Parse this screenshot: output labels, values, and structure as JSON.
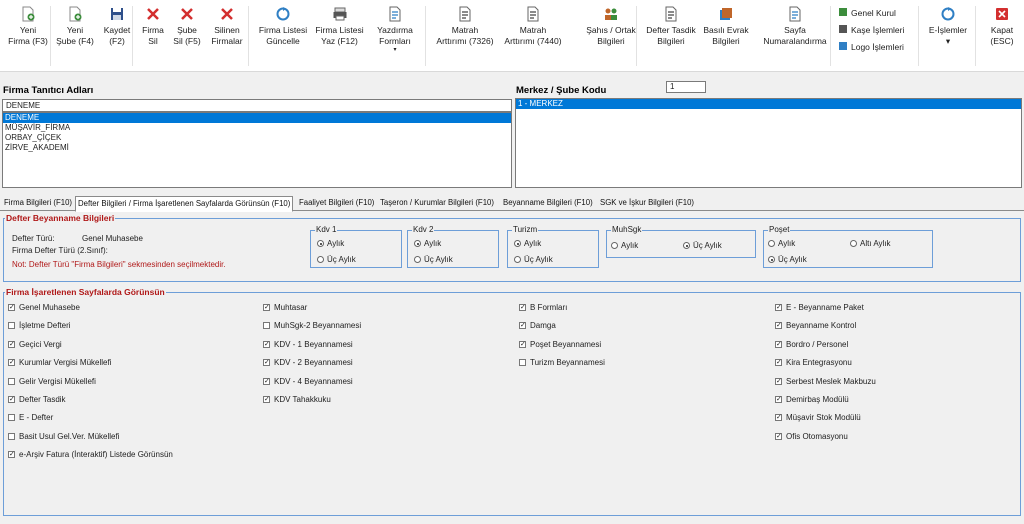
{
  "toolbar": {
    "buttons": [
      {
        "label1": "Yeni",
        "label2": "Firma (F3)",
        "icon": "new-company-icon",
        "color": "#3c8d3c"
      },
      {
        "label1": "Yeni",
        "label2": "Şube (F4)",
        "icon": "new-branch-icon",
        "color": "#3c8d3c"
      },
      {
        "label1": "Kaydet",
        "label2": "(F2)",
        "icon": "save-icon",
        "color": "#2e4f8a"
      },
      {
        "label1": "Firma",
        "label2": "Sil",
        "icon": "delete-company-icon",
        "color": "#d32f2f"
      },
      {
        "label1": "Şube",
        "label2": "Sil (F5)",
        "icon": "delete-branch-icon",
        "color": "#d32f2f"
      },
      {
        "label1": "Silinen",
        "label2": "Firmalar",
        "icon": "deleted-companies-icon",
        "color": "#d32f2f"
      },
      {
        "label1": "Firma Listesi",
        "label2": "Güncelle",
        "icon": "refresh-list-icon",
        "color": "#2f7fc4"
      },
      {
        "label1": "Firma Listesi",
        "label2": "Yaz (F12)",
        "icon": "print-list-icon",
        "color": "#555555"
      },
      {
        "label1": "Yazdırma",
        "label2": "Formları",
        "icon": "print-forms-icon",
        "color": "#2f7fc4"
      },
      {
        "label1": "Matrah",
        "label2": "Arttırımı (7326)",
        "icon": "tax-base-increase-icon",
        "color": "#444444"
      },
      {
        "label1": "Matrah",
        "label2": "Arttırımı (7440)",
        "icon": "tax-base-increase-icon",
        "color": "#444444"
      },
      {
        "label1": "Şahıs / Ortak",
        "label2": "Bilgileri",
        "icon": "partners-icon",
        "color": "#c0662a"
      },
      {
        "label1": "Defter Tasdik",
        "label2": "Bilgileri",
        "icon": "ledger-approval-icon",
        "color": "#444444"
      },
      {
        "label1": "Basılı Evrak",
        "label2": "Bilgileri",
        "icon": "printed-docs-icon",
        "color": "#c0662a"
      },
      {
        "label1": "Sayfa",
        "label2": "Numaralandırma",
        "icon": "page-numbering-icon",
        "color": "#2f7fc4"
      },
      {
        "label1": "E-İşlemler",
        "label2": "▾",
        "icon": "e-operations-icon",
        "color": "#2f7fc4"
      },
      {
        "label1": "Kapat",
        "label2": "(ESC)",
        "icon": "close-icon",
        "color": "#d32f2f"
      }
    ],
    "side_items": [
      {
        "label": "Genel Kurul",
        "icon": "general-assembly-icon"
      },
      {
        "label": "Kaşe İşlemleri",
        "icon": "stamp-icon"
      },
      {
        "label": "Logo İşlemleri",
        "icon": "logo-icon"
      }
    ],
    "dropdown_marker": "▾"
  },
  "company_panel": {
    "title": "Firma Tanıtıcı Adları",
    "input_value": "DENEME",
    "items": [
      "DENEME",
      "MÜŞAVİR_FİRMA",
      "ORBAY_ÇİÇEK",
      "ZİRVE_AKADEMİ"
    ],
    "selected_index": 0
  },
  "branch_panel": {
    "title": "Merkez / Şube Kodu",
    "code_value": "1",
    "items": [
      "1 - MERKEZ"
    ],
    "selected_index": 0
  },
  "tabs": [
    "Firma Bilgileri (F10)",
    "Defter Bilgileri / Firma İşaretlenen Sayfalarda Görünsün (F10)",
    "Faaliyet Bilgileri (F10)",
    "Taşeron / Kurumlar Bilgileri (F10)",
    "Beyanname Bilgileri (F10)",
    "SGK ve İşkur Bilgileri (F10)"
  ],
  "active_tab": 1,
  "declaration_info": {
    "title": "Defter Beyanname Bilgileri",
    "ledger_type_label": "Defter Türü:",
    "ledger_type_value": "Genel Muhasebe",
    "company_ledger_type_label": "Firma Defter Türü (2.Sınıf):",
    "note": "Not: Defter Türü \"Firma Bilgileri\" sekmesinden seçilmektedir.",
    "groups": [
      {
        "title": "Kdv 1",
        "options": [
          "Aylık",
          "Üç Aylık"
        ],
        "selected": 0
      },
      {
        "title": "Kdv 2",
        "options": [
          "Aylık",
          "Üç Aylık"
        ],
        "selected": 0
      },
      {
        "title": "Turizm",
        "options": [
          "Aylık",
          "Üç Aylık"
        ],
        "selected": 0
      },
      {
        "title": "MuhSgk",
        "options": [
          "Aylık",
          "Üç Aylık"
        ],
        "selected": 1
      },
      {
        "title": "Poşet",
        "options": [
          "Aylık",
          "Altı Aylık",
          "Üç Aylık"
        ],
        "selected": 2
      }
    ]
  },
  "visibility": {
    "title": "Firma İşaretlenen Sayfalarda Görünsün",
    "columns": [
      [
        {
          "label": "Genel Muhasebe",
          "checked": true
        },
        {
          "label": "İşletme Defteri",
          "checked": false
        },
        {
          "label": "Geçici Vergi",
          "checked": true
        },
        {
          "label": "Kurumlar Vergisi Mükellefi",
          "checked": true
        },
        {
          "label": "Gelir Vergisi Mükellefi",
          "checked": false
        },
        {
          "label": "Defter Tasdik",
          "checked": true
        },
        {
          "label": "E - Defter",
          "checked": false
        },
        {
          "label": "Basit Usul Gel.Ver. Mükellefi",
          "checked": false
        },
        {
          "label": "e-Arşiv Fatura (İnteraktif) Listede Görünsün",
          "checked": true
        }
      ],
      [
        {
          "label": "Muhtasar",
          "checked": true
        },
        {
          "label": "MuhSgk-2 Beyannamesi",
          "checked": false
        },
        {
          "label": "KDV - 1 Beyannamesi",
          "checked": true
        },
        {
          "label": "KDV - 2 Beyannamesi",
          "checked": true
        },
        {
          "label": "KDV - 4 Beyannamesi",
          "checked": true
        },
        {
          "label": "KDV Tahakkuku",
          "checked": true
        }
      ],
      [
        {
          "label": "B Formları",
          "checked": true
        },
        {
          "label": "Damga",
          "checked": true
        },
        {
          "label": "Poşet Beyannamesi",
          "checked": true
        },
        {
          "label": "Turizm Beyannamesi",
          "checked": false
        }
      ],
      [
        {
          "label": "E - Beyanname Paket",
          "checked": true
        },
        {
          "label": "Beyanname Kontrol",
          "checked": true
        },
        {
          "label": "Bordro / Personel",
          "checked": true
        },
        {
          "label": "Kira Entegrasyonu",
          "checked": true
        },
        {
          "label": "Serbest Meslek Makbuzu",
          "checked": true
        },
        {
          "label": "Demirbaş Modülü",
          "checked": true
        },
        {
          "label": "Müşavir Stok Modülü",
          "checked": true
        },
        {
          "label": "Ofis Otomasyonu",
          "checked": true
        }
      ]
    ]
  },
  "colors": {
    "selection": "#0078d7",
    "section_border": "#6d9ed8",
    "section_title": "#b01818"
  }
}
